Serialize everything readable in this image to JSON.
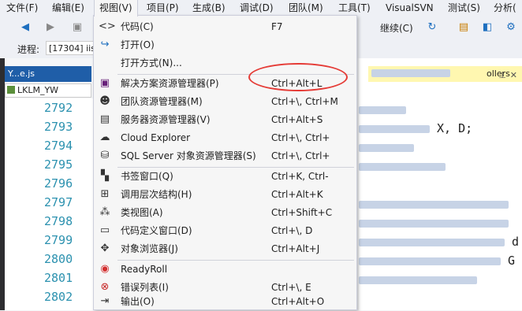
{
  "menubar": {
    "items": [
      "文件(F)",
      "编辑(E)",
      "视图(V)",
      "项目(P)",
      "生成(B)",
      "调试(D)",
      "团队(M)",
      "工具(T)",
      "VisualSVN",
      "测试(S)",
      "分析("
    ]
  },
  "toolbar": {
    "continue_label": "继续(C)"
  },
  "process": {
    "label": "进程:",
    "value": "[17304] iis"
  },
  "editor": {
    "tab_label": "Y...e.js",
    "breadcrumb": "LKLM_YW",
    "line_numbers": [
      "2792",
      "2793",
      "2794",
      "2795",
      "2796",
      "2797",
      "2798",
      "2799",
      "2800",
      "2801",
      "2802"
    ]
  },
  "right_pane": {
    "title_fragment": "ollers",
    "code_fragments": [
      "X, D;",
      "d",
      "G"
    ]
  },
  "view_menu": {
    "items": [
      {
        "icon": "code-icon",
        "label": "代码(C)",
        "shortcut": "F7"
      },
      {
        "icon": "open-icon",
        "label": "打开(O)",
        "shortcut": ""
      },
      {
        "icon": "",
        "label": "打开方式(N)...",
        "shortcut": ""
      },
      {
        "icon": "solution-explorer-icon",
        "label": "解决方案资源管理器(P)",
        "shortcut": "Ctrl+Alt+L"
      },
      {
        "icon": "team-explorer-icon",
        "label": "团队资源管理器(M)",
        "shortcut": "Ctrl+\\, Ctrl+M"
      },
      {
        "icon": "server-explorer-icon",
        "label": "服务器资源管理器(V)",
        "shortcut": "Ctrl+Alt+S"
      },
      {
        "icon": "cloud-icon",
        "label": "Cloud Explorer",
        "shortcut": "Ctrl+\\, Ctrl+"
      },
      {
        "icon": "sql-server-icon",
        "label": "SQL Server 对象资源管理器(S)",
        "shortcut": "Ctrl+\\, Ctrl+"
      },
      {
        "icon": "bookmark-icon",
        "label": "书签窗口(Q)",
        "shortcut": "Ctrl+K, Ctrl-"
      },
      {
        "icon": "call-hierarchy-icon",
        "label": "调用层次结构(H)",
        "shortcut": "Ctrl+Alt+K"
      },
      {
        "icon": "class-view-icon",
        "label": "类视图(A)",
        "shortcut": "Ctrl+Shift+C"
      },
      {
        "icon": "code-definition-icon",
        "label": "代码定义窗口(D)",
        "shortcut": "Ctrl+\\, D"
      },
      {
        "icon": "object-browser-icon",
        "label": "对象浏览器(J)",
        "shortcut": "Ctrl+Alt+J"
      },
      {
        "icon": "readyroll-icon",
        "label": "ReadyRoll",
        "shortcut": ""
      },
      {
        "icon": "error-list-icon",
        "label": "错误列表(I)",
        "shortcut": "Ctrl+\\, E"
      },
      {
        "icon": "output-icon",
        "label": "输出(O)",
        "shortcut": "Ctrl+Alt+O"
      }
    ]
  },
  "colors": {
    "highlight_ellipse": "#e53b36",
    "tab_active": "#1f5ea8",
    "line_number": "#2b91af"
  }
}
